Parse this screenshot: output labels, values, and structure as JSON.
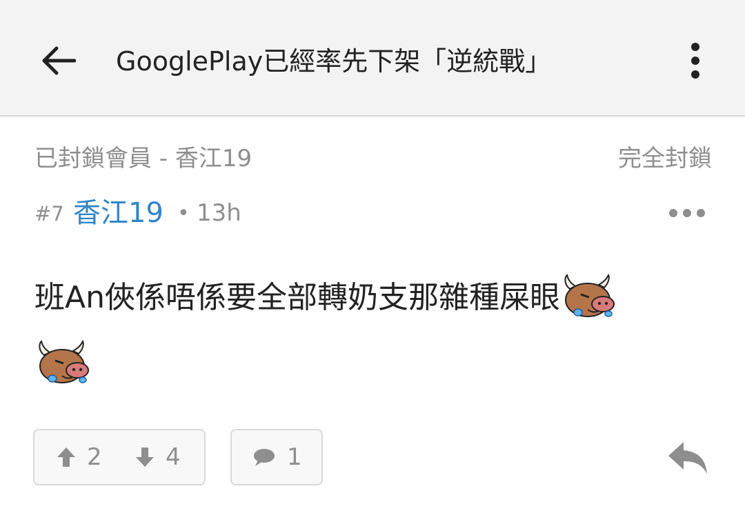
{
  "header": {
    "title": "GooglePlay已經率先下架「逆統戰」",
    "back_icon": "arrow-left-icon",
    "menu_icon": "more-vertical-icon"
  },
  "blocked_notice": {
    "label": "已封鎖會員 - 香江19",
    "action": "完全封鎖"
  },
  "post": {
    "number": "#7",
    "author": "香江19",
    "separator": "•",
    "time": "13h",
    "content_line1": "班An俠係唔係要全部轉奶支那雜種屎眼",
    "emoji_icon": "crying-bull-emoji-icon",
    "more_icon": "more-horizontal-icon"
  },
  "actions": {
    "upvotes": "2",
    "downvotes": "4",
    "replies": "1",
    "reply_icon": "reply-arrow-icon"
  },
  "colors": {
    "author_link": "#2f86c8",
    "muted_text": "#8e8e8e",
    "appbar_bg": "#f3f3f3"
  }
}
